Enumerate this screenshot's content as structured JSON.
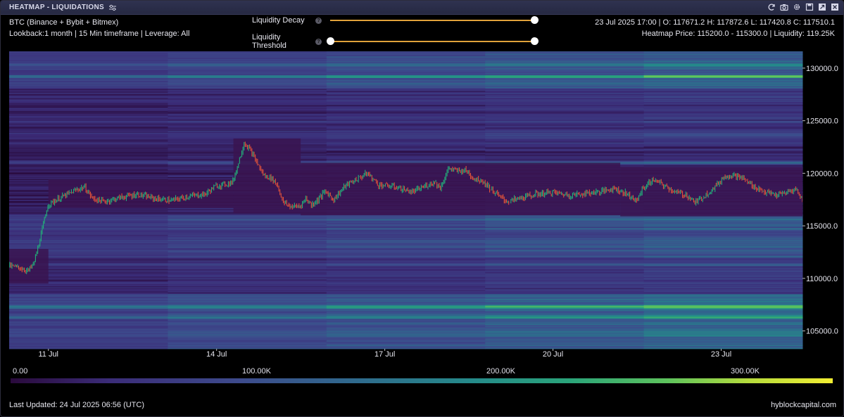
{
  "window": {
    "title": "HEATMAP - LIQUIDATIONS",
    "toolbar_icons": [
      "refresh-icon",
      "camera-icon",
      "gear-icon",
      "save-icon",
      "expand-icon",
      "close-icon"
    ]
  },
  "info": {
    "symbol_line": "BTC (Binance + Bybit + Bitmex)",
    "settings_line": "Lookback:1 month | 15 Min timeframe | Leverage: All",
    "ohlc_line": "23 Jul 2025 17:00 | O: 117671.2 H: 117872.6 L: 117420.8 C: 117510.1",
    "heatmap_line": "Heatmap Price: 115200.0 - 115300.0 | Liquidity: 119.25K"
  },
  "controls": {
    "decay_label": "Liquidity Decay",
    "threshold_label": "Liquidity Threshold",
    "decay_value": 1.0,
    "threshold_range": [
      0.0,
      1.0
    ]
  },
  "colorbar": {
    "labels": [
      "0.00",
      "100.00K",
      "200.00K",
      "300.00K"
    ]
  },
  "footer": {
    "updated": "Last Updated: 24 Jul 2025 06:56 (UTC)",
    "brand": "hyblockcapital.com"
  },
  "colors": {
    "accent": "#e0a23a",
    "candle_up": "#22b07a",
    "candle_down": "#e0523a",
    "titlebar": "#2f3250"
  },
  "chart_data": {
    "type": "heatmap",
    "x_ticks": [
      "11 Jul",
      "14 Jul",
      "17 Jul",
      "20 Jul",
      "23 Jul"
    ],
    "y_ticks": [
      "105000.0",
      "110000.0",
      "115000.0",
      "120000.0",
      "125000.0",
      "130000.0"
    ],
    "y_tick_values": [
      105000,
      110000,
      115000,
      120000,
      125000,
      130000
    ],
    "ylim": [
      103300,
      131600
    ],
    "x_tick_days": [
      11,
      14,
      17,
      20,
      23
    ],
    "xlim_days": [
      10.3,
      24.45
    ],
    "price_path": [
      [
        10.3,
        111200
      ],
      [
        10.5,
        111000
      ],
      [
        10.65,
        110700
      ],
      [
        10.75,
        111400
      ],
      [
        10.85,
        113500
      ],
      [
        10.95,
        115800
      ],
      [
        11.0,
        117000
      ],
      [
        11.2,
        117600
      ],
      [
        11.5,
        118400
      ],
      [
        11.65,
        118700
      ],
      [
        11.8,
        117600
      ],
      [
        12.0,
        117300
      ],
      [
        12.3,
        117700
      ],
      [
        12.6,
        118000
      ],
      [
        12.9,
        117600
      ],
      [
        13.2,
        117400
      ],
      [
        13.5,
        117800
      ],
      [
        13.8,
        118000
      ],
      [
        14.0,
        118800
      ],
      [
        14.2,
        119000
      ],
      [
        14.3,
        119200
      ],
      [
        14.4,
        121000
      ],
      [
        14.5,
        122900
      ],
      [
        14.6,
        122300
      ],
      [
        14.75,
        120800
      ],
      [
        14.85,
        119800
      ],
      [
        15.0,
        119500
      ],
      [
        15.1,
        118800
      ],
      [
        15.2,
        117200
      ],
      [
        15.35,
        116800
      ],
      [
        15.5,
        116900
      ],
      [
        15.6,
        117600
      ],
      [
        15.7,
        117000
      ],
      [
        15.8,
        117400
      ],
      [
        15.95,
        118300
      ],
      [
        16.1,
        117500
      ],
      [
        16.3,
        118800
      ],
      [
        16.5,
        119400
      ],
      [
        16.7,
        120000
      ],
      [
        16.9,
        118900
      ],
      [
        17.2,
        118700
      ],
      [
        17.5,
        118200
      ],
      [
        17.7,
        118700
      ],
      [
        17.9,
        119200
      ],
      [
        18.0,
        118600
      ],
      [
        18.15,
        120500
      ],
      [
        18.3,
        120200
      ],
      [
        18.45,
        120300
      ],
      [
        18.6,
        119500
      ],
      [
        18.75,
        119300
      ],
      [
        18.9,
        118500
      ],
      [
        19.05,
        117800
      ],
      [
        19.2,
        117300
      ],
      [
        19.4,
        117600
      ],
      [
        19.7,
        118000
      ],
      [
        20.0,
        118200
      ],
      [
        20.3,
        117900
      ],
      [
        20.6,
        118100
      ],
      [
        20.9,
        118300
      ],
      [
        21.1,
        118600
      ],
      [
        21.3,
        118100
      ],
      [
        21.4,
        117800
      ],
      [
        21.5,
        117300
      ],
      [
        21.6,
        118500
      ],
      [
        21.8,
        119400
      ],
      [
        22.0,
        118800
      ],
      [
        22.2,
        118200
      ],
      [
        22.4,
        117900
      ],
      [
        22.55,
        117200
      ],
      [
        22.7,
        117800
      ],
      [
        22.9,
        118700
      ],
      [
        23.0,
        119300
      ],
      [
        23.1,
        119800
      ],
      [
        23.25,
        119800
      ],
      [
        23.4,
        119500
      ],
      [
        23.6,
        118700
      ],
      [
        23.8,
        118200
      ],
      [
        24.0,
        117900
      ],
      [
        24.2,
        118200
      ],
      [
        24.35,
        118500
      ],
      [
        24.45,
        117500
      ]
    ]
  }
}
